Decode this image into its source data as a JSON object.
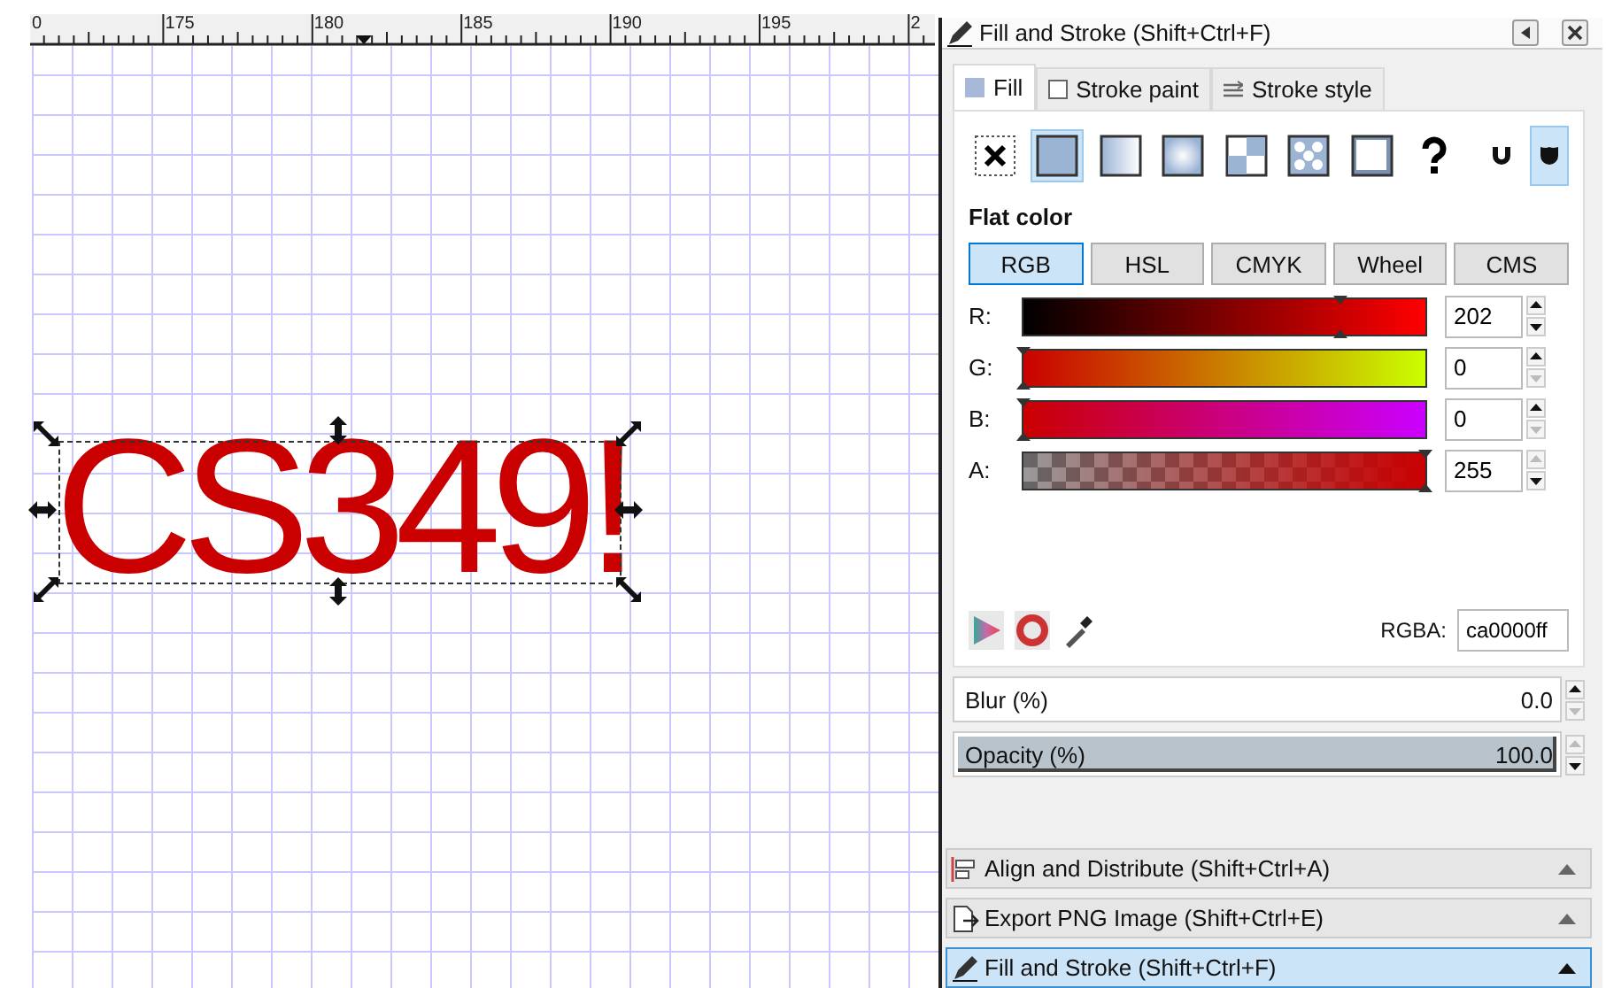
{
  "ruler": {
    "labels": [
      "0",
      "175",
      "180",
      "185",
      "190",
      "195",
      "2"
    ]
  },
  "canvas": {
    "text": "CS349!",
    "color": "#ca0000",
    "selected": true
  },
  "dialog": {
    "title": "Fill and Stroke (Shift+Ctrl+F)",
    "tabs": [
      {
        "label": "Fill",
        "kind": "fill",
        "selected": true
      },
      {
        "label": "Stroke paint",
        "kind": "stroke",
        "selected": false
      },
      {
        "label": "Stroke style",
        "kind": "style",
        "selected": false
      }
    ],
    "paint_types": [
      {
        "kind": "none",
        "selected": false
      },
      {
        "kind": "flat",
        "selected": true
      },
      {
        "kind": "linear",
        "selected": false
      },
      {
        "kind": "radial",
        "selected": false
      },
      {
        "kind": "mesh",
        "selected": false
      },
      {
        "kind": "pattern",
        "selected": false
      },
      {
        "kind": "swatch",
        "selected": false
      },
      {
        "kind": "unset",
        "selected": false
      }
    ],
    "fill_rules": [
      {
        "kind": "evenodd",
        "selected": false
      },
      {
        "kind": "nonzero",
        "selected": true
      }
    ],
    "mode_label": "Flat color",
    "color_modes": [
      {
        "label": "RGB",
        "selected": true
      },
      {
        "label": "HSL",
        "selected": false
      },
      {
        "label": "CMYK",
        "selected": false
      },
      {
        "label": "Wheel",
        "selected": false
      },
      {
        "label": "CMS",
        "selected": false
      }
    ],
    "channels": [
      {
        "kind": "r",
        "label": "R:",
        "value": "202",
        "level": 0.79,
        "can_increase": true,
        "can_decrease": true
      },
      {
        "kind": "g",
        "label": "G:",
        "value": "0",
        "level": 0,
        "can_increase": true,
        "can_decrease": false
      },
      {
        "kind": "b",
        "label": "B:",
        "value": "0",
        "level": 0,
        "can_increase": true,
        "can_decrease": false
      },
      {
        "kind": "a",
        "label": "A:",
        "value": "255",
        "level": 1,
        "can_increase": false,
        "can_decrease": true
      }
    ],
    "rgba": {
      "label": "RGBA:",
      "value": "ca0000ff"
    },
    "blur": {
      "label": "Blur (%)",
      "value": "0.0",
      "can_increase": true,
      "can_decrease": false
    },
    "opacity": {
      "label": "Opacity (%)",
      "value": "100.0",
      "level": 1,
      "can_increase": false,
      "can_decrease": true
    }
  },
  "docked": [
    {
      "kind": "align",
      "title": "Align and Distribute (Shift+Ctrl+A)",
      "selected": false
    },
    {
      "kind": "export",
      "title": "Export PNG Image (Shift+Ctrl+E)",
      "selected": false
    },
    {
      "kind": "fill",
      "title": "Fill and Stroke (Shift+Ctrl+F)",
      "selected": true
    }
  ]
}
